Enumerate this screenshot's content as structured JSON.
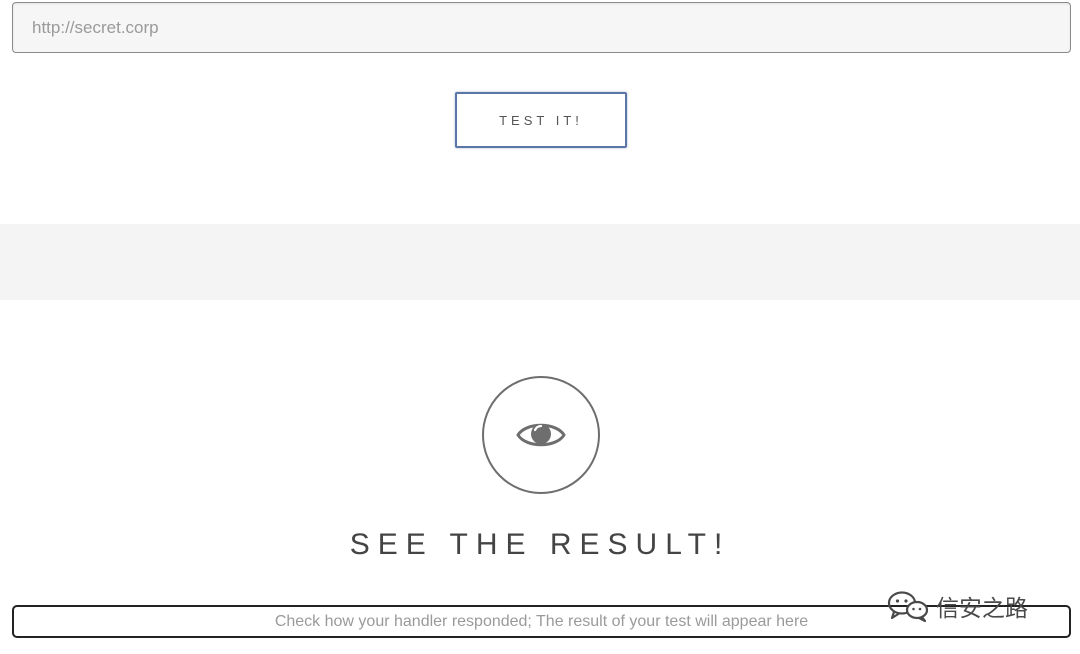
{
  "form": {
    "url_placeholder": "http://secret.corp",
    "test_button_label": "TEST IT!"
  },
  "result": {
    "title": "SEE THE RESULT!",
    "message": "Check how your handler responded; The result of your test will appear here",
    "icon": "eye-icon"
  },
  "watermark": {
    "text": "信安之路",
    "icon": "wechat-icon"
  },
  "colors": {
    "button_border": "#5a77a8",
    "band": "#f4f4f4",
    "icon": "#6e6e6e"
  }
}
